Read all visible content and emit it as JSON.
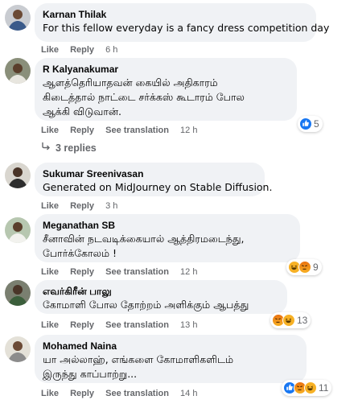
{
  "comments": [
    {
      "author": "Karnan Thilak",
      "text": "For this fellow everyday is a fancy dress competition day",
      "actions": {
        "like": "Like",
        "reply": "Reply",
        "time": "6 h"
      }
    },
    {
      "author": "R Kalyanakumar",
      "lines": [
        "ஆளத்தெரியாதவன் கையில் அதிகாரம்",
        "கிடைத்தால் நாட்டை சர்க்கஸ் கூடாரம் போல",
        "ஆக்கி விடுவான்."
      ],
      "actions": {
        "like": "Like",
        "reply": "Reply",
        "see_translation": "See translation",
        "time": "12 h"
      },
      "reaction_count": "5",
      "replies": "3 replies"
    },
    {
      "author": "Sukumar Sreenivasan",
      "text": "Generated on MidJourney on Stable Diffusion.",
      "actions": {
        "like": "Like",
        "reply": "Reply",
        "time": "3 h"
      }
    },
    {
      "author": "Meganathan SB",
      "lines": [
        "சீனாவின் நடவடிக்கையால் ஆத்திரமடைந்து,",
        "போர்க்கோலம் !"
      ],
      "actions": {
        "like": "Like",
        "reply": "Reply",
        "see_translation": "See translation",
        "time": "12 h"
      },
      "reaction_count": "9"
    },
    {
      "author": "எவர்கிரீன் பாலு",
      "lines": [
        "கோமாளி போல தோற்றம் அளிக்கும் ஆபத்து"
      ],
      "actions": {
        "like": "Like",
        "reply": "Reply",
        "see_translation": "See translation",
        "time": "13 h"
      },
      "reaction_count": "13"
    },
    {
      "author": "Mohamed Naina",
      "lines": [
        "யா அல்லாஹ், எங்களை கோமாளிகளிடம்",
        "இருந்து காப்பாற்று..."
      ],
      "actions": {
        "like": "Like",
        "reply": "Reply",
        "see_translation": "See translation",
        "time": "14 h"
      },
      "reaction_count": "11"
    }
  ],
  "colors": {
    "bubble": "#f0f2f5",
    "secondary_text": "#65676b",
    "like_blue": "#1877f2",
    "haha_yellow": "#f7b125",
    "angry_red": "#e9710f"
  },
  "icons": [
    "like-reaction-icon",
    "haha-reaction-icon",
    "angry-reaction-icon",
    "reply-arrow-icon"
  ]
}
